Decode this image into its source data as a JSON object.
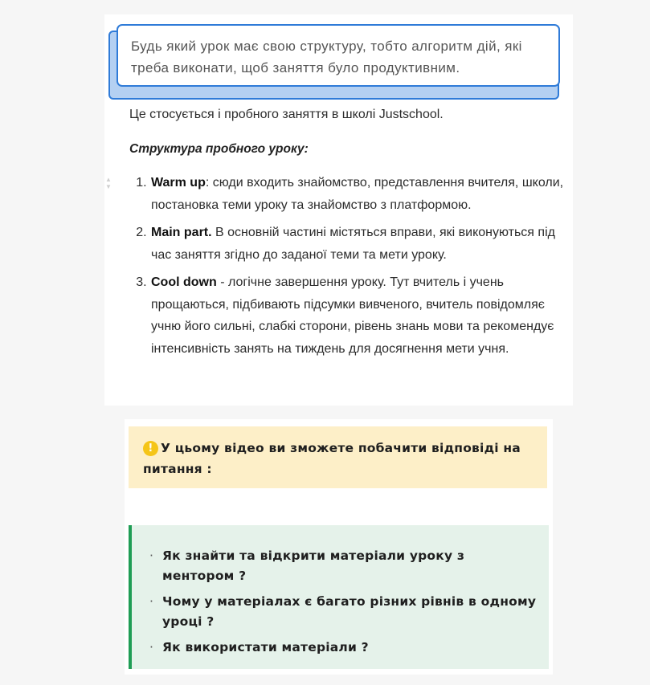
{
  "callout": {
    "text": "Будь який урок має свою структуру, тобто алгоритм дій, які треба виконати, щоб заняття було продуктивним."
  },
  "article": {
    "intro": "Це стосується і пробного заняття в школі Justschool.",
    "structure_title": "Структура пробного уроку:",
    "steps": [
      {
        "term": "Warm up",
        "text": ": сюди входить знайомство, представлення вчителя, школи, постановка теми уроку та знайомство з платформою."
      },
      {
        "term": "Main part.",
        "text": " В основній частині містяться вправи, які виконуються під час заняття згідно до заданої теми та мети уроку."
      },
      {
        "term": "Cool down",
        "text": " - логічне завершення уроку. Тут вчитель і учень прощаються, підбивають підсумки вивченого, вчитель повідомляє учню його сильні, слабкі сторони, рівень знань мови та рекомендує інтенсивність занять на тиждень для досягнення мети учня."
      }
    ],
    "handle_icon": "reorder-arrows-icon"
  },
  "video_note": {
    "icon": "warning-icon",
    "icon_glyph": "!",
    "text": "У цьому відео ви зможете побачити відповіді на питання :"
  },
  "questions": {
    "bullet": "·",
    "items": [
      "Як знайти та відкрити матеріали уроку з ментором ?",
      "Чому у матеріалах є багато різних рівнів в одному уроці ?",
      "Як використати  матеріали ?"
    ]
  },
  "colors": {
    "callout_border": "#2f7bd8",
    "callout_shadow": "#b4d0f2",
    "warning_bg": "#fdefc8",
    "warning_icon": "#f5c518",
    "questions_bg": "#e5f2ea",
    "questions_accent": "#1f9d55"
  }
}
